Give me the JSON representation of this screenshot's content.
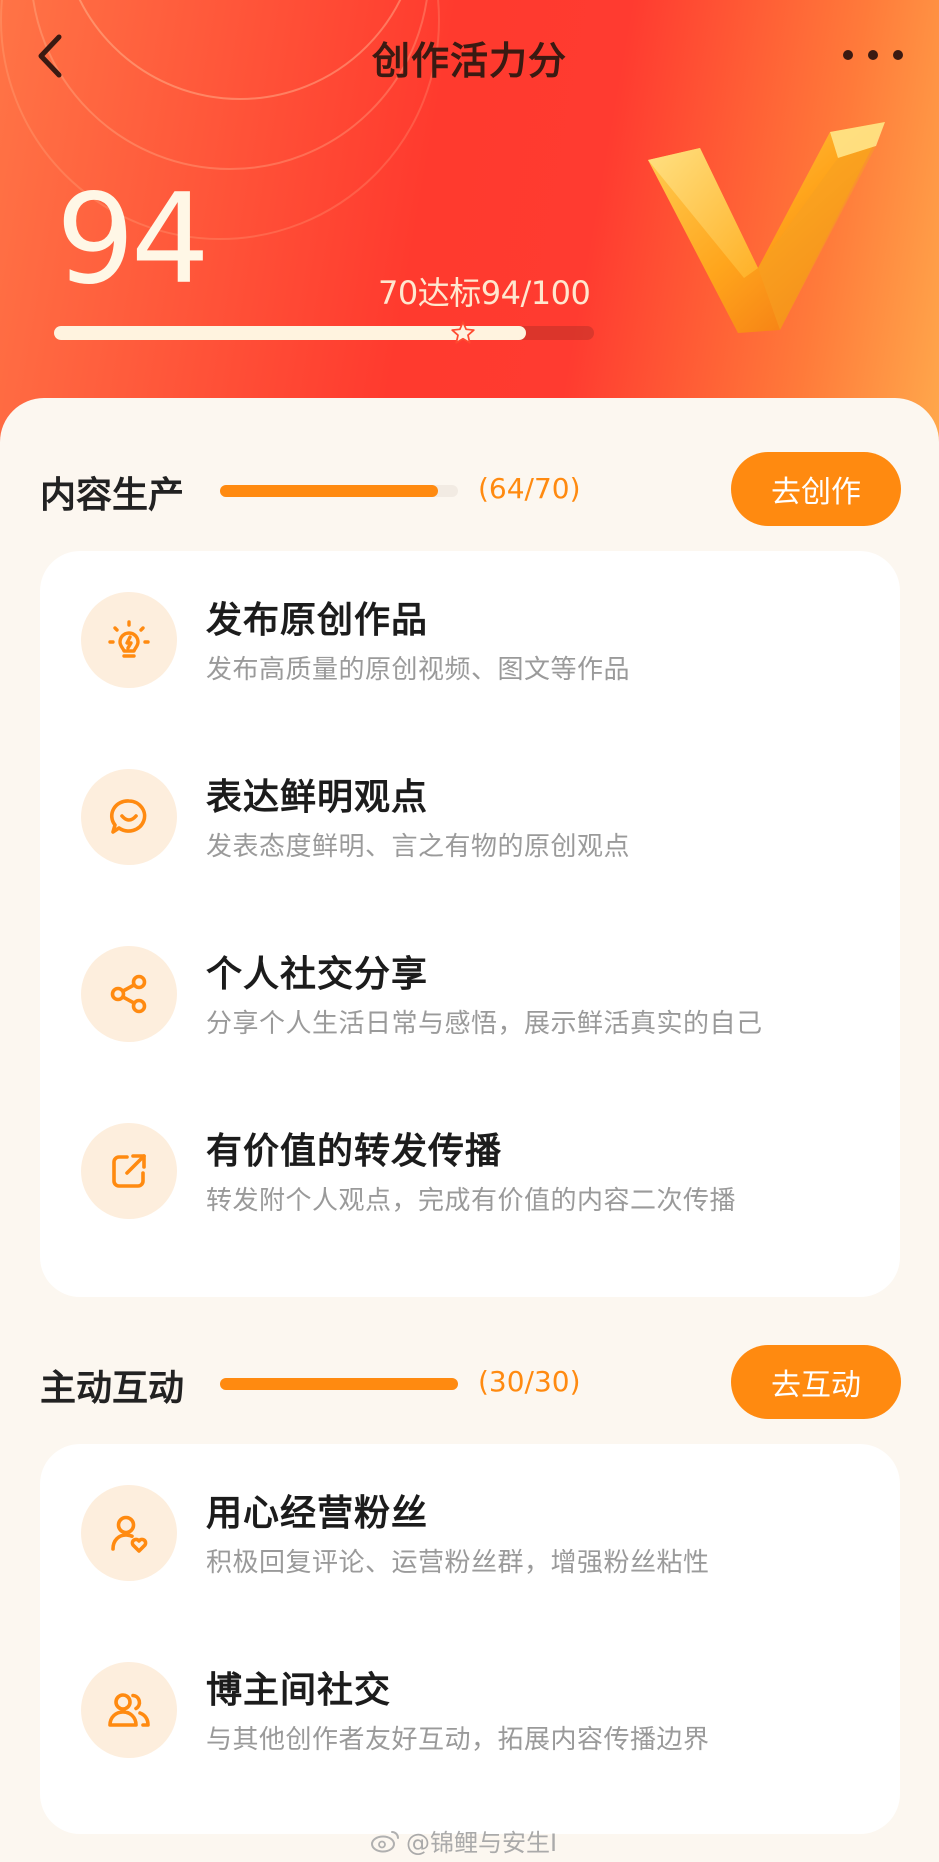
{
  "header": {
    "title": "创作活力分",
    "back_icon": "chevron-left-icon",
    "more_icon": "more-horizontal-icon"
  },
  "score": {
    "value": "94",
    "goal_text": "70达标94/100",
    "progress": 0.94,
    "threshold": 0.7,
    "badge_icon": "v-badge-icon"
  },
  "sections": [
    {
      "title": "内容生产",
      "count": "(64/70)",
      "progress": 0.914,
      "button": "去创作",
      "items": [
        {
          "title": "发布原创作品",
          "desc": "发布高质量的原创视频、图文等作品",
          "icon": "lightbulb-icon"
        },
        {
          "title": "表达鲜明观点",
          "desc": "发表态度鲜明、言之有物的原创观点",
          "icon": "speech-bubble-icon"
        },
        {
          "title": "个人社交分享",
          "desc": "分享个人生活日常与感悟，展示鲜活真实的自己",
          "icon": "share-icon"
        },
        {
          "title": "有价值的转发传播",
          "desc": "转发附个人观点，完成有价值的内容二次传播",
          "icon": "forward-icon"
        }
      ]
    },
    {
      "title": "主动互动",
      "count": "(30/30)",
      "progress": 1.0,
      "button": "去互动",
      "items": [
        {
          "title": "用心经营粉丝",
          "desc": "积极回复评论、运营粉丝群，增强粉丝粘性",
          "icon": "user-heart-icon"
        },
        {
          "title": "博主间社交",
          "desc": "与其他创作者友好互动，拓展内容传播边界",
          "icon": "users-icon"
        }
      ]
    }
  ],
  "watermark": "@锦鲤与安生I",
  "colors": {
    "accent": "#ff8a10",
    "hero_red": "#ff3a2e",
    "hero_orange": "#ffa94c",
    "icon_bg": "#fdeedd"
  }
}
